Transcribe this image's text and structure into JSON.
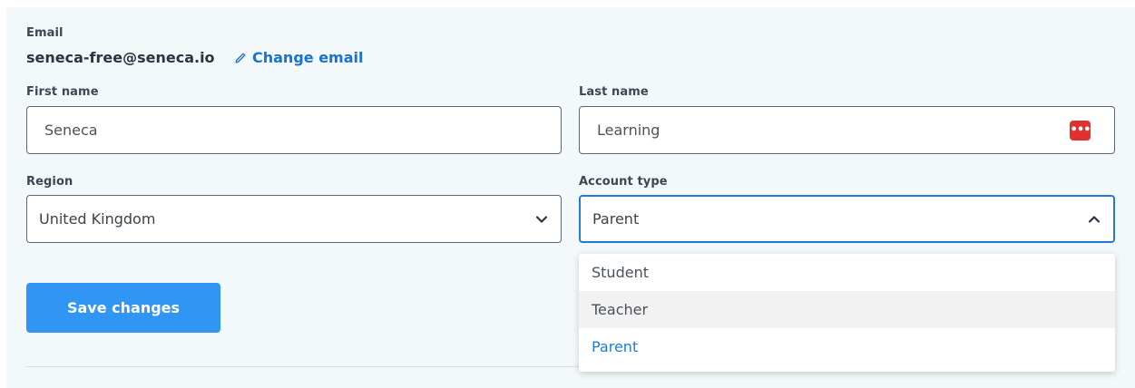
{
  "email": {
    "label": "Email",
    "value": "seneca-free@seneca.io",
    "change_label": "Change email"
  },
  "first_name": {
    "label": "First name",
    "value": "Seneca"
  },
  "last_name": {
    "label": "Last name",
    "value": "Learning",
    "password_manager_icon": "dots-icon",
    "password_manager_icon_text": "•••"
  },
  "region": {
    "label": "Region",
    "value": "United Kingdom"
  },
  "account_type": {
    "label": "Account type",
    "value": "Parent",
    "expanded": true,
    "options": [
      "Student",
      "Teacher",
      "Parent"
    ],
    "hovered_option": "Teacher",
    "selected_option": "Parent"
  },
  "save_label": "Save changes",
  "colors": {
    "accent": "#1f7bd8",
    "button": "#3196f3",
    "panel_bg": "#f3f8fa",
    "pw_icon": "#e03131"
  }
}
